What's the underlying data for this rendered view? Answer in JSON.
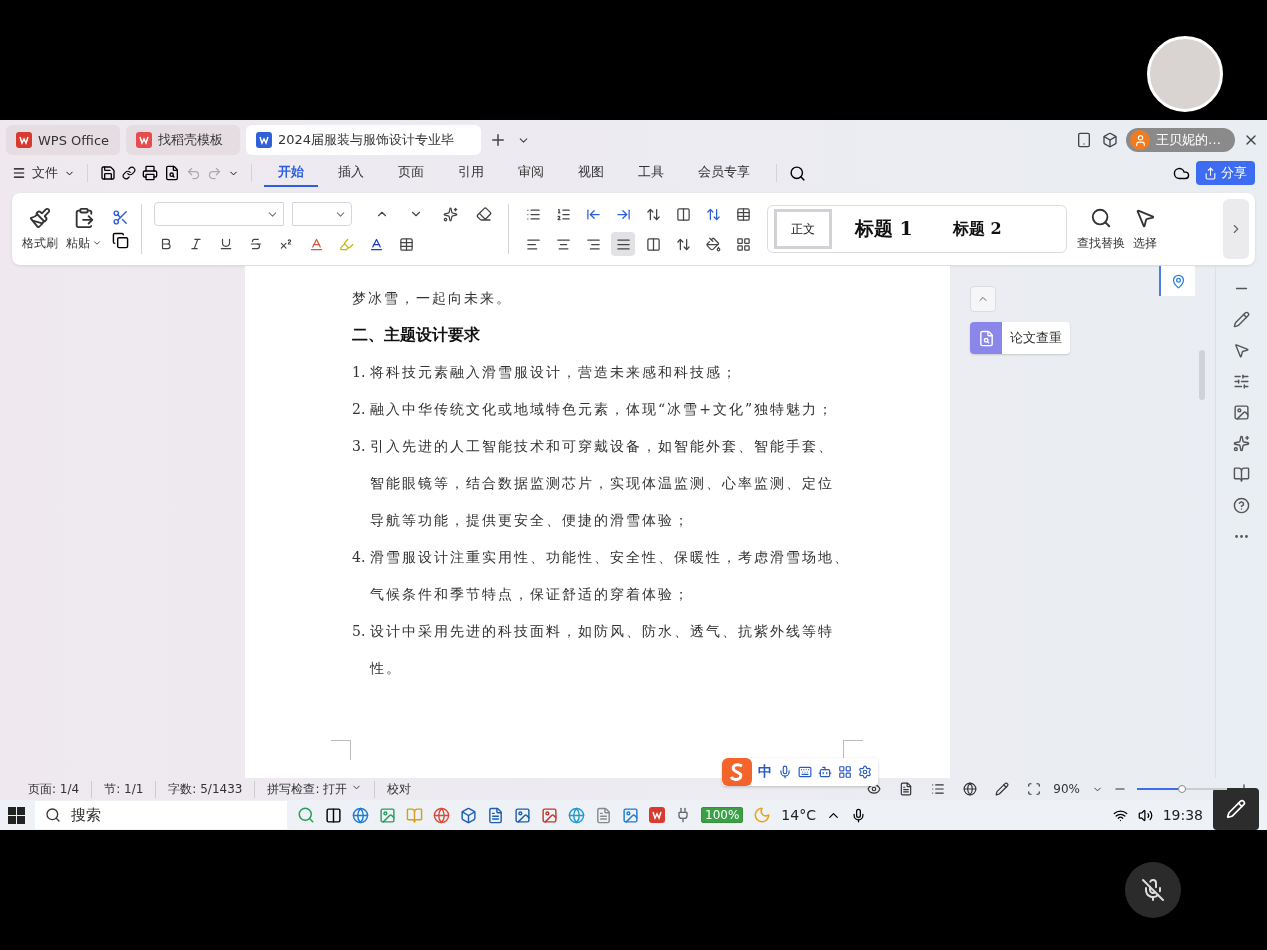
{
  "window_tabs": [
    {
      "label": "WPS Office",
      "kind": "home",
      "selected": false
    },
    {
      "label": "找稻壳模板",
      "kind": "template",
      "selected": false
    },
    {
      "label": "2024届服装与服饰设计专业毕",
      "kind": "document",
      "selected": true
    }
  ],
  "user": {
    "name": "王贝妮的…"
  },
  "menu": {
    "file": "文件",
    "share": "分享",
    "tabs": [
      {
        "label": "开始",
        "selected": true
      },
      {
        "label": "插入",
        "selected": false
      },
      {
        "label": "页面",
        "selected": false
      },
      {
        "label": "引用",
        "selected": false
      },
      {
        "label": "审阅",
        "selected": false
      },
      {
        "label": "视图",
        "selected": false
      },
      {
        "label": "工具",
        "selected": false
      },
      {
        "label": "会员专享",
        "selected": false
      }
    ]
  },
  "ribbon": {
    "format_painter": "格式刷",
    "paste": "粘贴",
    "find_replace": "查找替换",
    "select": "选择",
    "alignment": [
      {
        "kind": "left",
        "selected": false
      },
      {
        "kind": "center",
        "selected": false
      },
      {
        "kind": "right",
        "selected": false
      },
      {
        "kind": "justify",
        "selected": true
      }
    ],
    "styles": [
      {
        "label": "正文",
        "kind": "body",
        "selected": true
      },
      {
        "label": "标题 1",
        "kind": "h1",
        "selected": false
      },
      {
        "label": "标题 2",
        "kind": "h2",
        "selected": false
      }
    ]
  },
  "document": {
    "paragraphs": [
      {
        "kind": "text",
        "lines": [
          "梦冰雪，一起向未来。"
        ]
      },
      {
        "kind": "heading",
        "lines": [
          "二、主题设计要求"
        ]
      },
      {
        "kind": "item",
        "number": "1.",
        "lines": [
          "将科技元素融入滑雪服设计，营造未来感和科技感；"
        ]
      },
      {
        "kind": "item",
        "number": "2.",
        "lines": [
          "融入中华传统文化或地域特色元素，体现“冰雪+文化”独特魅力；"
        ]
      },
      {
        "kind": "item",
        "number": "3.",
        "lines": [
          "引入先进的人工智能技术和可穿戴设备，如智能外套、智能手套、",
          "智能眼镜等，结合数据监测芯片，实现体温监测、心率监测、定位",
          "导航等功能，提供更安全、便捷的滑雪体验；"
        ]
      },
      {
        "kind": "item",
        "number": "4.",
        "lines": [
          "滑雪服设计注重实用性、功能性、安全性、保暖性，考虑滑雪场地、",
          "气候条件和季节特点，保证舒适的穿着体验；"
        ]
      },
      {
        "kind": "item",
        "number": "5.",
        "lines": [
          "设计中采用先进的科技面料，如防风、防水、透气、抗紫外线等特",
          "性。"
        ]
      }
    ]
  },
  "side_panel": {
    "paper_check": "论文查重"
  },
  "status_bar": {
    "page": "页面: 1/4",
    "section": "节: 1/1",
    "words": "字数: 5/1433",
    "spell_check": "拼写检查: 打开",
    "proofread": "校对",
    "zoom": "90%",
    "zoom_slider": {
      "level": 0.5
    }
  },
  "ime": {
    "mode": "中"
  },
  "taskbar": {
    "search_placeholder": "搜索",
    "battery": "100%",
    "weather": "14°C",
    "clock": "19:38"
  }
}
